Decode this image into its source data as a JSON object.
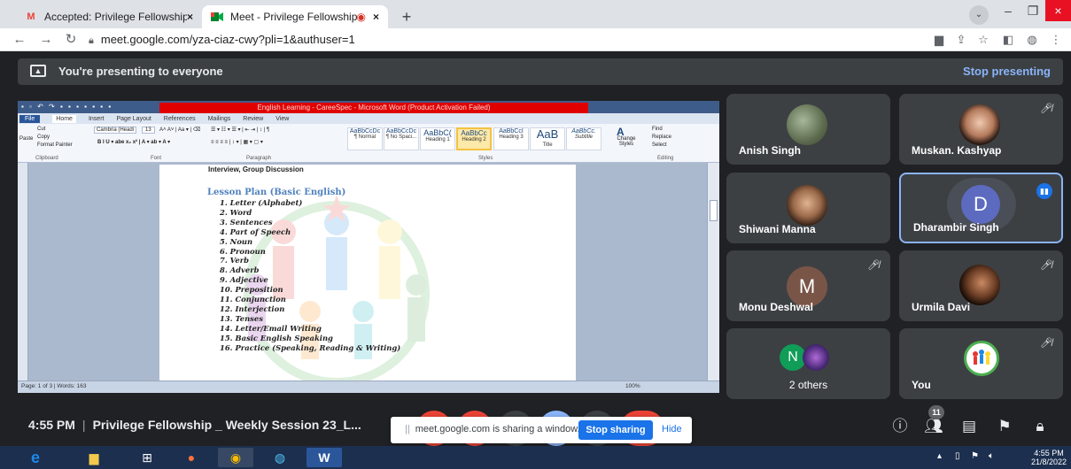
{
  "browser": {
    "tabs": [
      {
        "favicon": "gmail-icon",
        "title": "Accepted: Privilege Fellowship _",
        "active": false
      },
      {
        "favicon": "meet-icon",
        "title": "Meet - Privilege Fellowship _",
        "active": true,
        "recording": true
      }
    ],
    "url": "meet.google.com/yza-ciaz-cwy?pli=1&authuser=1"
  },
  "presenting": {
    "message": "You're presenting to everyone",
    "stop_label": "Stop presenting"
  },
  "shared_window": {
    "title": "English Learning - CareeSpec - Microsoft Word (Product Activation Failed)",
    "ribbon_tabs": [
      "File",
      "Home",
      "Insert",
      "Page Layout",
      "References",
      "Mailings",
      "Review",
      "View"
    ],
    "ribbon_groups": [
      "Clipboard",
      "Font",
      "Paragraph",
      "Styles",
      "Editing"
    ],
    "clipboard": {
      "cut": "Cut",
      "copy": "Copy",
      "paste": "Paste",
      "format_painter": "Format Painter"
    },
    "font_name": "Cambria (Headi",
    "font_size": "13",
    "styles": [
      {
        "sample": "AaBbCcDc",
        "name": "¶ Normal"
      },
      {
        "sample": "AaBbCcDc",
        "name": "¶ No Spaci..."
      },
      {
        "sample": "AaBbC(",
        "name": "Heading 1"
      },
      {
        "sample": "AaBbCc",
        "name": "Heading 2"
      },
      {
        "sample": "AaBbCcI",
        "name": "Heading 3"
      },
      {
        "sample": "AaB",
        "name": "Title"
      },
      {
        "sample": "AaBbCc.",
        "name": "Subtitle"
      }
    ],
    "change_styles": "Change Styles",
    "editing": [
      "Find",
      "Replace",
      "Select"
    ],
    "page_top_text": "Interview, Group Discussion",
    "lesson_title": "Lesson Plan (Basic English)",
    "lesson_items": [
      "1.  Letter (Alphabet)",
      "2.  Word",
      "3.  Sentences",
      "4.  Part of Speech",
      "5.  Noun",
      "6.  Pronoun",
      "7.  Verb",
      "8.  Adverb",
      "9.  Adjective",
      "10. Preposition",
      "11. Conjunction",
      "12. Interjection",
      "13. Tenses",
      "14. Letter/Email Writing",
      "15. Basic English Speaking",
      "16. Practice (Speaking, Reading & Writing)"
    ],
    "status": "Page: 1 of 3  |  Words: 163",
    "zoom": "100%"
  },
  "participants": [
    {
      "name": "Anish Singh",
      "muted": false
    },
    {
      "name": "Muskan. Kashyap",
      "muted": true
    },
    {
      "name": "Shiwani Manna",
      "muted": false
    },
    {
      "name": "Dharambir Singh",
      "initial": "D",
      "speaking": true,
      "color": "#5c6bc0"
    },
    {
      "name": "Monu Deshwal",
      "initial": "M",
      "muted": true,
      "color": "#795548"
    },
    {
      "name": "Urmila Davi",
      "muted": true
    },
    {
      "others_initial": "N",
      "label": "2 others",
      "color": "#0f9d58"
    },
    {
      "name": "You",
      "muted": true
    }
  ],
  "meeting": {
    "time": "4:55 PM",
    "title": "Privilege Fellowship _ Weekly Session 23_L...",
    "participant_count": "11"
  },
  "share_popup": {
    "message": "meet.google.com is sharing a window.",
    "stop_label": "Stop sharing",
    "hide_label": "Hide"
  },
  "taskbar": {
    "time": "4:55 PM",
    "date": "21/8/2022"
  },
  "colors": {
    "meet_bg": "#202124",
    "tile_bg": "#3c4043",
    "accent_blue": "#8ab4f8",
    "button_blue": "#1a73e8",
    "word_title_red": "#e00000"
  }
}
